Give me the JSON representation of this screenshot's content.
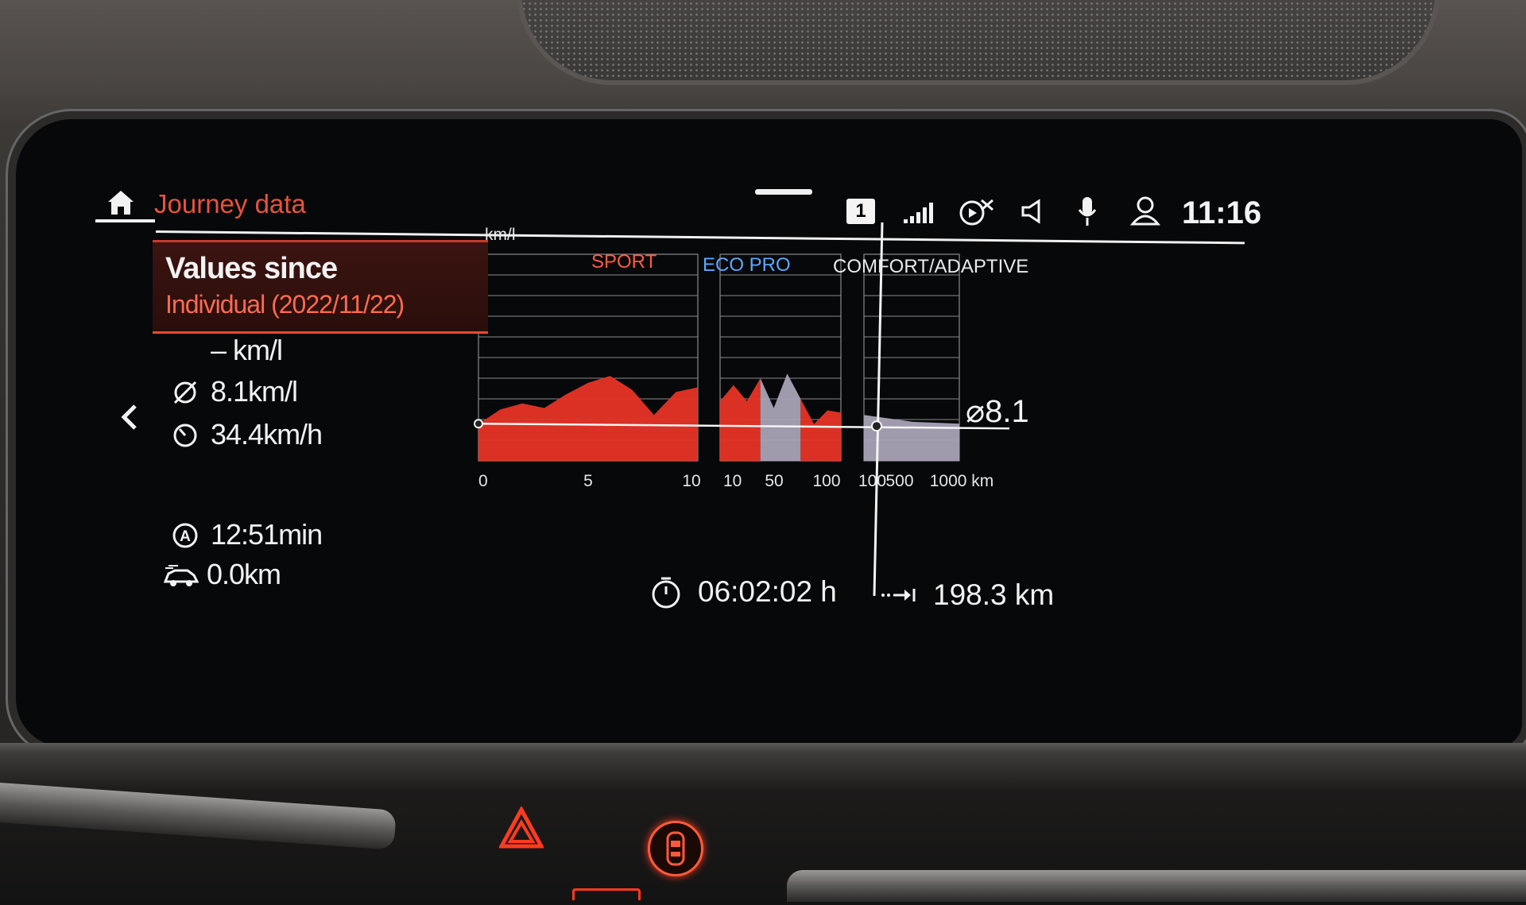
{
  "header": {
    "title": "Journey data",
    "profile_number": "1",
    "clock": "11:16"
  },
  "values_since": {
    "title": "Values since",
    "subtitle": "Individual (2022/11/22)"
  },
  "stats": {
    "current_consumption": "– km/l",
    "average_consumption": "8.1km/l",
    "average_speed": "34.4km/h",
    "driving_time": "12:51min",
    "electric_distance": "0.0km"
  },
  "modes": {
    "sport": "SPORT",
    "eco_pro": "ECO PRO",
    "comfort": "COMFORT/ADAPTIVE"
  },
  "footer": {
    "trip_time": "06:02:02 h",
    "trip_distance": "198.3 km"
  },
  "colors": {
    "accent_red": "#e63426",
    "title_red": "#e9523e",
    "comfort_fill": "#a9a2b6",
    "grid": "#8a8a8a"
  },
  "chart_data": {
    "type": "area",
    "ylabel": "km/l",
    "ytick_top": "45",
    "ylim": [
      0,
      45
    ],
    "average": 8.1,
    "average_label": "⌀8.1",
    "panels": [
      {
        "name": "0-10 km",
        "xticks": [
          "0",
          "5",
          "10"
        ],
        "x": [
          0,
          1,
          2,
          3,
          4,
          5,
          6,
          7,
          8,
          9,
          10
        ],
        "series": [
          {
            "values": [
              8.0,
              11.2,
              12.5,
              11.5,
              14.5,
              17.0,
              18.5,
              15.5,
              10.0,
              15.0,
              16.0
            ],
            "mode": "SPORT"
          }
        ]
      },
      {
        "name": "10-100 km",
        "xticks": [
          "10",
          "50",
          "100"
        ],
        "x": [
          10,
          20,
          30,
          40,
          50,
          60,
          70,
          80,
          90,
          100
        ],
        "series": [
          {
            "values": [
              13.0,
              16.5,
              13.0,
              18.0,
              11.5,
              19.0,
              13.5,
              8.0,
              11.0,
              10.5
            ],
            "mode": "SPORT/COMFORT"
          }
        ]
      },
      {
        "name": "100-1000 km",
        "xticks": [
          "100",
          "500",
          "1000 km"
        ],
        "x": [
          100,
          150,
          198
        ],
        "series": [
          {
            "values": [
              10.0,
              8.5,
              8.1
            ],
            "mode": "COMFORT"
          }
        ]
      }
    ]
  }
}
